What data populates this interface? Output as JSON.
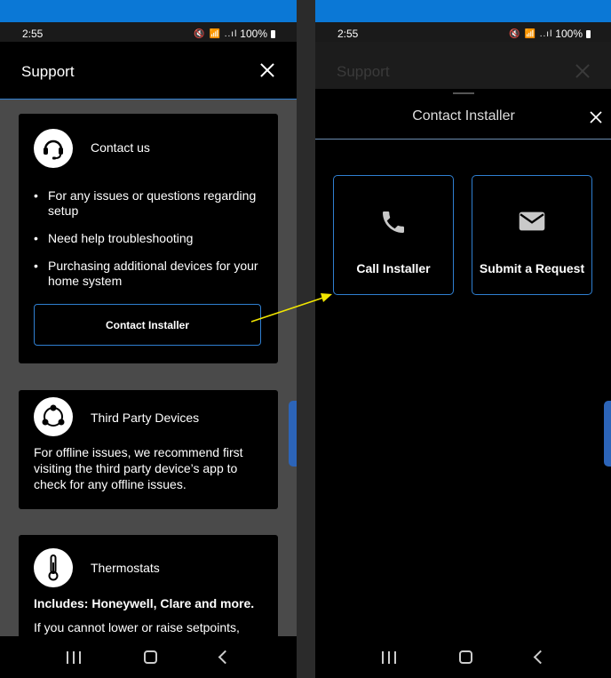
{
  "left_screen": {
    "status_bar": {
      "time": "2:55",
      "icons": "🔇 📶 ..ıl",
      "battery": "100%"
    },
    "header": {
      "title": "Support"
    },
    "contact_card": {
      "title": "Contact us",
      "bullets": [
        "For any issues or questions regarding setup",
        "Need help troubleshooting",
        "Purchasing additional devices for your home system"
      ],
      "button_label": "Contact Installer"
    },
    "third_party_card": {
      "title": "Third Party Devices",
      "text": "For offline issues, we recommend first visiting the third party device’s app to check for any offline issues."
    },
    "thermostats_card": {
      "title": "Thermostats",
      "subtitle": "Includes: Honeywell, Clare and more.",
      "text": "If you cannot lower or raise setpoints,"
    }
  },
  "right_screen": {
    "status_bar": {
      "time": "2:55",
      "icons": "🔇 📶 ..ıl",
      "battery": "100%"
    },
    "background_header": {
      "title": "Support"
    },
    "sheet": {
      "title": "Contact Installer",
      "options": [
        {
          "label": "Call Installer",
          "icon": "phone-icon"
        },
        {
          "label": "Submit a Request",
          "icon": "mail-icon"
        }
      ]
    }
  },
  "annotation": {
    "arrow_color": "#f2e600"
  },
  "colors": {
    "accent": "#2f7fd1",
    "top_bar": "#0b78d6"
  }
}
